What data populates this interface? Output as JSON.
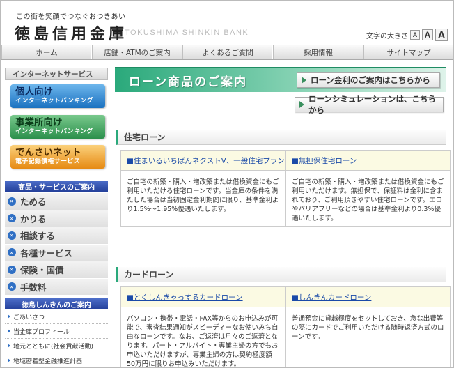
{
  "header": {
    "tagline": "この街を笑顔でつなぐおつきあい",
    "logo_jp": "徳島信用金庫",
    "logo_en": "TOKUSHIMA SHINKIN BANK",
    "font_size_label": "文字の大きさ",
    "font_size_buttons": [
      "A",
      "A",
      "A"
    ]
  },
  "gnav": [
    "ホーム",
    "店舗・ATMのご案内",
    "よくあるご質問",
    "採用情報",
    "サイトマップ"
  ],
  "sidebar": {
    "internet_head": "インターネットサービス",
    "ib_buttons": [
      {
        "title": "個人向け",
        "sub": "インターネットバンキング"
      },
      {
        "title": "事業所向け",
        "sub": "インターネットバンキング"
      },
      {
        "title": "でんさいネット",
        "sub": "電子記録債権サービス"
      }
    ],
    "product_head": "商品・サービスのご案内",
    "products": [
      "ためる",
      "かりる",
      "相談する",
      "各種サービス",
      "保険・国債",
      "手数料"
    ],
    "about_head": "徳島しんきんのご案内",
    "about": [
      "ごあいさつ",
      "当金庫プロフィール",
      "地元とともに(社会貢献活動)",
      "地域密着型金融推進計画"
    ]
  },
  "main": {
    "banner_title": "ローン商品のご案内",
    "rate_link": "ローン金利のご案内はこちらから",
    "sim_link": "ローンシミュレーションは、こちらから",
    "sections": [
      {
        "title": "住宅ローン",
        "cards": [
          {
            "link": "■住まいるいちばんネクストV、一般住宅プラン",
            "body": "ご自宅の新築・購入・増改築または借換資金にもご利用いただける住宅ローンです。当金庫の条件を満たした場合は当初固定金利期間に限り、基準金利より1.5%～1.95%優遇いたします。"
          },
          {
            "link": "■無担保住宅ローン",
            "body": "ご自宅の新築・購入・増改築または借換資金にもご利用いただけます。無担保で、保証料は金利に含まれており、ご利用頂きやすい住宅ローンです。エコやバリアフリーなどの場合は基準金利より0.3%優遇いたします。"
          }
        ]
      },
      {
        "title": "カードローン",
        "cards": [
          {
            "link": "■とくしんきゃっするカードローン",
            "body": "パソコン・携帯・電話・FAX等からのお申込みが可能で、審査結果通知がスピーディーなお使いみち自由なローンです。なお、ご返済は月々のご返済となります。パート・アルバイト・専業主婦の方でもお申込いただけますが、専業主婦の方は契約極度額50万円に限りお申込みいただけます。"
          },
          {
            "link": "■しんきんカードローン",
            "body": "普通預金に貸越極度をセットしておき、急な出費等の際にカードでご利用いただける随時返済方式のローンです。"
          }
        ]
      }
    ]
  },
  "colors": {
    "accent_green": "#2aa97b",
    "nav_blue": "#24409a",
    "link_blue": "#1a4aa8"
  }
}
